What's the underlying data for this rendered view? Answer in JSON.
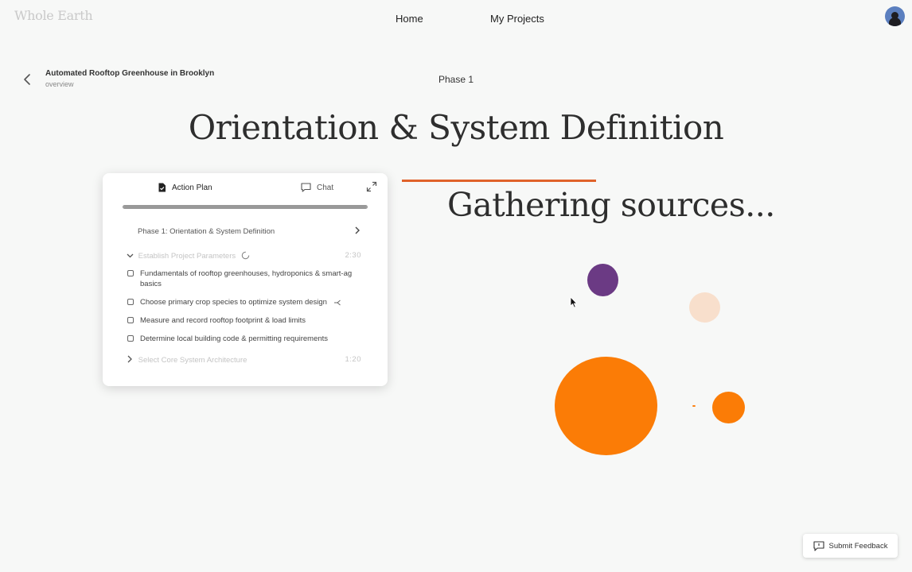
{
  "app": {
    "logo": "Whole Earth"
  },
  "nav": {
    "home": "Home",
    "projects": "My Projects"
  },
  "project": {
    "title": "Automated Rooftop Greenhouse in Brooklyn",
    "subtitle": "overview",
    "phase": "Phase 1"
  },
  "hero": {
    "title": "Orientation & System Definition",
    "status": "Gathering sources..."
  },
  "panel": {
    "tab_plan": "Action Plan",
    "tab_chat": "Chat",
    "progress": 1.0,
    "phase_row": "Phase 1: Orientation & System Definition",
    "sections": [
      {
        "title": "Establish Project Parameters",
        "time": "2:30",
        "tasks": [
          "Fundamentals of rooftop greenhouses, hydroponics & smart-ag basics",
          "Choose primary crop species to optimize system design",
          "Measure and record rooftop footprint & load limits",
          "Determine local building code & permitting requirements"
        ]
      },
      {
        "title": "Select Core System Architecture",
        "time": "1:20"
      }
    ]
  },
  "feedback": {
    "label": "Submit Feedback"
  },
  "colors": {
    "accent": "#e0622a",
    "orange": "#fb7c06",
    "purple": "#6b3a84",
    "peach": "#f8dfcc"
  }
}
